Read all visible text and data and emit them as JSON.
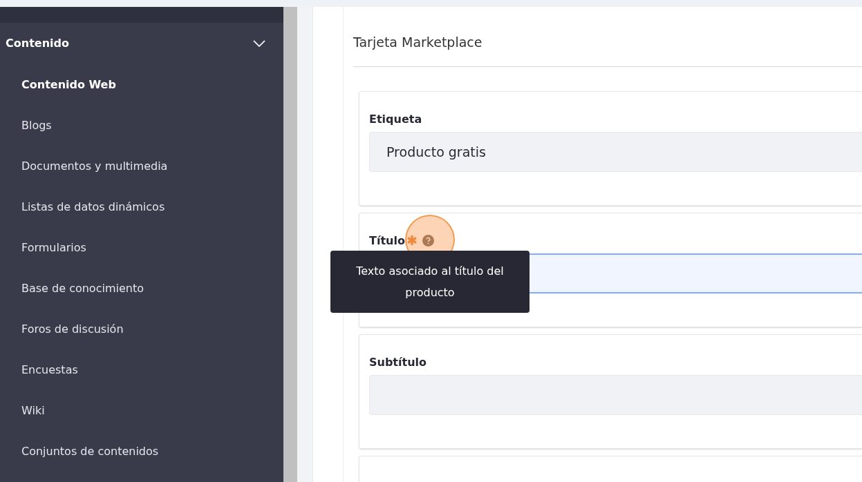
{
  "sidebar": {
    "section": {
      "label": "Contenido",
      "expanded": true
    },
    "items": [
      {
        "label": "Contenido Web",
        "selected": true
      },
      {
        "label": "Blogs",
        "selected": false
      },
      {
        "label": "Documentos y multimedia",
        "selected": false
      },
      {
        "label": "Listas de datos dinámicos",
        "selected": false
      },
      {
        "label": "Formularios",
        "selected": false
      },
      {
        "label": "Base de conocimiento",
        "selected": false
      },
      {
        "label": "Foros de discusión",
        "selected": false
      },
      {
        "label": "Encuestas",
        "selected": false
      },
      {
        "label": "Wiki",
        "selected": false
      },
      {
        "label": "Conjuntos de contenidos",
        "selected": false
      }
    ]
  },
  "panel": {
    "title": "Tarjeta Marketplace",
    "fields": [
      {
        "label": "Etiqueta",
        "required": false,
        "help": false,
        "value": "Producto gratis",
        "focused": false
      },
      {
        "label": "Título",
        "required": true,
        "help": true,
        "focused": true
      },
      {
        "label": "Subtítulo",
        "required": false,
        "help": false,
        "focused": false
      }
    ]
  },
  "tooltip": "Texto asociado al título del producto"
}
